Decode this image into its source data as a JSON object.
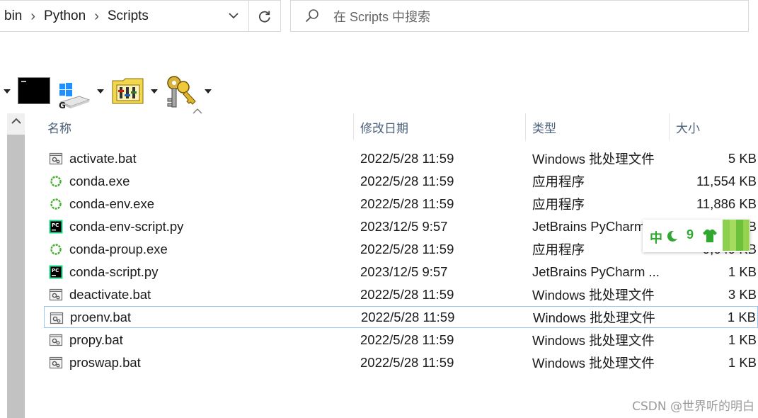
{
  "breadcrumb": [
    "bin",
    "Python",
    "Scripts"
  ],
  "search": {
    "placeholder": "在 Scripts 中搜索"
  },
  "columns": {
    "name": "名称",
    "date": "修改日期",
    "type": "类型",
    "size": "大小"
  },
  "files": [
    {
      "name": "activate.bat",
      "date": "2022/5/28 11:59",
      "type": "Windows 批处理文件",
      "size": "5 KB",
      "icon": "bat-file-icon"
    },
    {
      "name": "conda.exe",
      "date": "2022/5/28 11:59",
      "type": "应用程序",
      "size": "11,554 KB",
      "icon": "conda-exe-icon"
    },
    {
      "name": "conda-env.exe",
      "date": "2022/5/28 11:59",
      "type": "应用程序",
      "size": "11,886 KB",
      "icon": "conda-exe-icon"
    },
    {
      "name": "conda-env-script.py",
      "date": "2023/12/5 9:57",
      "type": "JetBrains PyCharm",
      "size": "1 KB",
      "icon": "pycharm-file-icon"
    },
    {
      "name": "conda-proup.exe",
      "date": "2022/5/28 11:59",
      "type": "应用程序",
      "size": "9,649 KB",
      "icon": "conda-exe-icon"
    },
    {
      "name": "conda-script.py",
      "date": "2023/12/5 9:57",
      "type": "JetBrains PyCharm ...",
      "size": "1 KB",
      "icon": "pycharm-file-icon"
    },
    {
      "name": "deactivate.bat",
      "date": "2022/5/28 11:59",
      "type": "Windows 批处理文件",
      "size": "3 KB",
      "icon": "bat-file-icon"
    },
    {
      "name": "proenv.bat",
      "date": "2022/5/28 11:59",
      "type": "Windows 批处理文件",
      "size": "1 KB",
      "icon": "bat-file-icon"
    },
    {
      "name": "propy.bat",
      "date": "2022/5/28 11:59",
      "type": "Windows 批处理文件",
      "size": "1 KB",
      "icon": "bat-file-icon"
    },
    {
      "name": "proswap.bat",
      "date": "2022/5/28 11:59",
      "type": "Windows 批处理文件",
      "size": "1 KB",
      "icon": "bat-file-icon"
    }
  ],
  "ime": {
    "mode": "中",
    "digit": "9",
    "accent": "#2fa82f"
  },
  "watermark": "CSDN @世界听的明白"
}
